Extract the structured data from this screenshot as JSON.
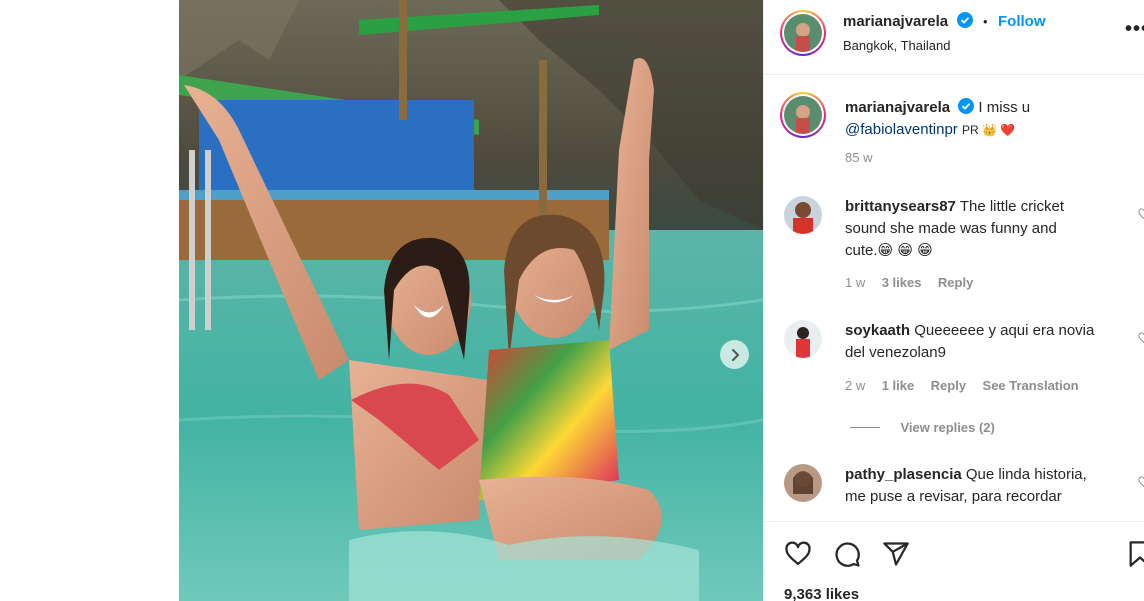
{
  "post": {
    "author": "marianajvarela",
    "follow_label": "Follow",
    "location": "Bangkok, Thailand",
    "separator": "•",
    "more_label": "•••"
  },
  "caption": {
    "author": "marianajvarela",
    "text": "I miss u",
    "mention": "@fabiolaventinpr",
    "flags": "PR 👑 ❤️",
    "age": "85 w"
  },
  "comments": [
    {
      "author": "brittanysears87",
      "text_line1": "The little cricket",
      "text_line2": "sound she made was funny and",
      "text_line3": "cute.😁 😁 😁",
      "age": "1 w",
      "likes": "3 likes",
      "reply": "Reply"
    },
    {
      "author": "soykaath",
      "text_line1": "Queeeeee y aqui era novia",
      "text_line2": "del venezolan9",
      "age": "2 w",
      "likes": "1 like",
      "reply": "Reply",
      "translate": "See Translation",
      "view_replies": "View replies (2)"
    },
    {
      "author": "pathy_plasencia",
      "text_line1": "Que linda historia,",
      "text_line2": "me puse a revisar, para recordar"
    }
  ],
  "actions": {
    "likes": "9,363 likes"
  },
  "colors": {
    "accent": "#0095f6",
    "text": "#262626",
    "muted": "#8e8e8e",
    "mention": "#00376b",
    "heart": "#ed4956"
  },
  "icons": [
    "chevron-right-icon",
    "verified-icon",
    "heart-icon",
    "comment-icon",
    "share-icon",
    "bookmark-icon",
    "more-icon"
  ]
}
